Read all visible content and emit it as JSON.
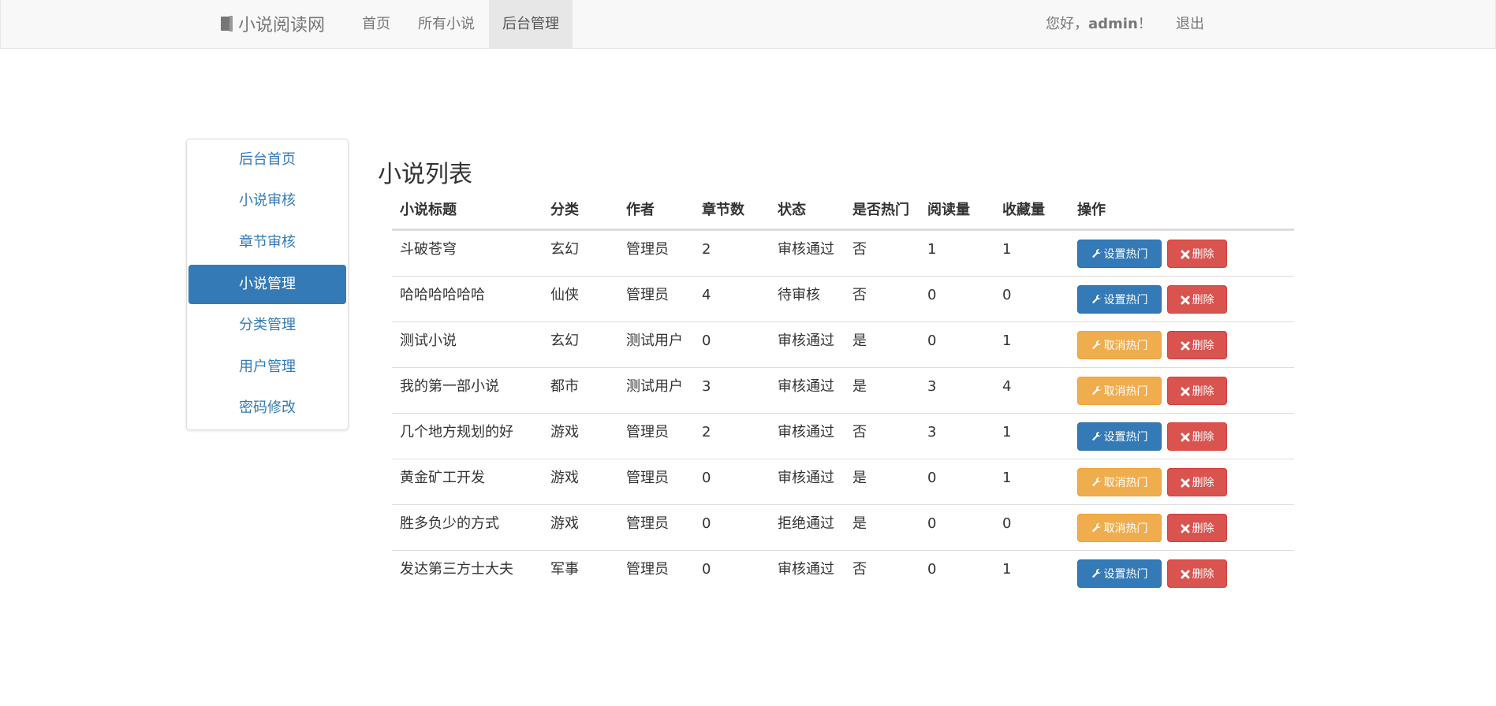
{
  "navbar": {
    "brand": "小说阅读网",
    "links": [
      "首页",
      "所有小说",
      "后台管理"
    ],
    "greeting_prefix": "您好，",
    "username": "admin",
    "greeting_suffix": "！",
    "logout": "退出"
  },
  "sidebar": {
    "items": [
      {
        "label": "后台首页",
        "active": false
      },
      {
        "label": "小说审核",
        "active": false
      },
      {
        "label": "章节审核",
        "active": false
      },
      {
        "label": "小说管理",
        "active": true
      },
      {
        "label": "分类管理",
        "active": false
      },
      {
        "label": "用户管理",
        "active": false
      },
      {
        "label": "密码修改",
        "active": false
      }
    ]
  },
  "main": {
    "title": "小说列表",
    "columns": [
      "小说标题",
      "分类",
      "作者",
      "章节数",
      "状态",
      "是否热门",
      "阅读量",
      "收藏量",
      "操作"
    ],
    "rows": [
      {
        "title": "斗破苍穹",
        "category": "玄幻",
        "author": "管理员",
        "chapters": "2",
        "status": "审核通过",
        "hot": "否",
        "reads": "1",
        "favorites": "1",
        "hot_action": "设置热门",
        "delete_action": "删除"
      },
      {
        "title": "哈哈哈哈哈哈",
        "category": "仙侠",
        "author": "管理员",
        "chapters": "4",
        "status": "待审核",
        "hot": "否",
        "reads": "0",
        "favorites": "0",
        "hot_action": "设置热门",
        "delete_action": "删除"
      },
      {
        "title": "测试小说",
        "category": "玄幻",
        "author": "测试用户",
        "chapters": "0",
        "status": "审核通过",
        "hot": "是",
        "reads": "0",
        "favorites": "1",
        "hot_action": "取消热门",
        "delete_action": "删除"
      },
      {
        "title": "我的第一部小说",
        "category": "都市",
        "author": "测试用户",
        "chapters": "3",
        "status": "审核通过",
        "hot": "是",
        "reads": "3",
        "favorites": "4",
        "hot_action": "取消热门",
        "delete_action": "删除"
      },
      {
        "title": "几个地方规划的好",
        "category": "游戏",
        "author": "管理员",
        "chapters": "2",
        "status": "审核通过",
        "hot": "否",
        "reads": "3",
        "favorites": "1",
        "hot_action": "设置热门",
        "delete_action": "删除"
      },
      {
        "title": "黄金矿工开发",
        "category": "游戏",
        "author": "管理员",
        "chapters": "0",
        "status": "审核通过",
        "hot": "是",
        "reads": "0",
        "favorites": "1",
        "hot_action": "取消热门",
        "delete_action": "删除"
      },
      {
        "title": "胜多负少的方式",
        "category": "游戏",
        "author": "管理员",
        "chapters": "0",
        "status": "拒绝通过",
        "hot": "是",
        "reads": "0",
        "favorites": "0",
        "hot_action": "取消热门",
        "delete_action": "删除"
      },
      {
        "title": "发达第三方士大夫",
        "category": "军事",
        "author": "管理员",
        "chapters": "0",
        "status": "审核通过",
        "hot": "否",
        "reads": "0",
        "favorites": "1",
        "hot_action": "设置热门",
        "delete_action": "删除"
      }
    ]
  },
  "colors": {
    "primary": "#337ab7",
    "warning": "#f0ad4e",
    "danger": "#d9534f",
    "navbar_bg": "#f8f8f8"
  },
  "icons": {
    "brand": "book-icon",
    "hot_action": "wrench-icon",
    "delete_action": "times-icon"
  }
}
